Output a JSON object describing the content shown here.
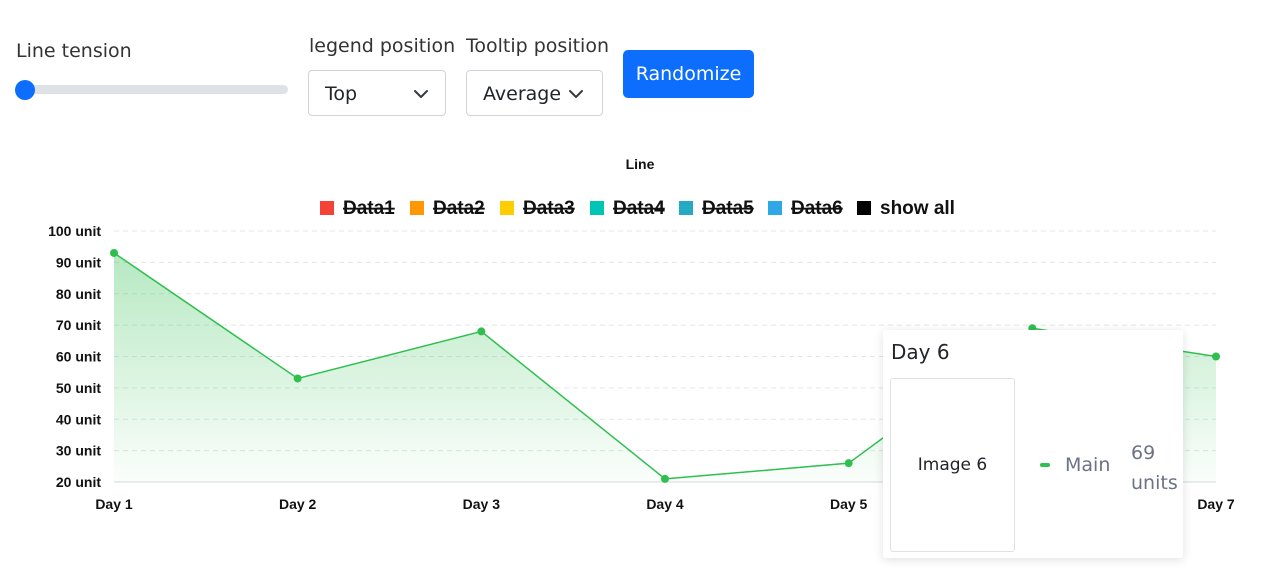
{
  "controls": {
    "tension_label": "Line tension",
    "tension_value": 0,
    "legend_position_label": "legend position",
    "legend_position_value": "Top",
    "tooltip_position_label": "Tooltip position",
    "tooltip_position_value": "Average",
    "randomize_label": "Randomize",
    "accent_color": "#0d6efd"
  },
  "chart_data": {
    "type": "area",
    "title": "Line",
    "categories": [
      "Day 1",
      "Day 2",
      "Day 3",
      "Day 4",
      "Day 5",
      "Day 6",
      "Day 7"
    ],
    "y_ticks": [
      "20 unit",
      "30 unit",
      "40 unit",
      "50 unit",
      "60 unit",
      "70 unit",
      "80 unit",
      "90 unit",
      "100 unit"
    ],
    "ylim": [
      20,
      100
    ],
    "grid": true,
    "legend_position": "top",
    "series": [
      {
        "name": "Main",
        "values": [
          93,
          53,
          68,
          21,
          26,
          69,
          60
        ],
        "color": "#2ebf4f",
        "visible": true
      }
    ],
    "legend": [
      {
        "label": "Data1",
        "color": "#f44336",
        "hidden": true
      },
      {
        "label": "Data2",
        "color": "#ff9800",
        "hidden": true
      },
      {
        "label": "Data3",
        "color": "#ffcc00",
        "hidden": true
      },
      {
        "label": "Data4",
        "color": "#00c4b4",
        "hidden": true
      },
      {
        "label": "Data5",
        "color": "#26a9c2",
        "hidden": true
      },
      {
        "label": "Data6",
        "color": "#2ea8e6",
        "hidden": true
      },
      {
        "label": "show all",
        "color": "#000000",
        "hidden": false
      }
    ]
  },
  "tooltip": {
    "title": "Day 6",
    "image_label": "Image 6",
    "series_name": "Main",
    "value_number": "69",
    "value_unit": "units",
    "swatch_color": "#2ebf4f"
  }
}
